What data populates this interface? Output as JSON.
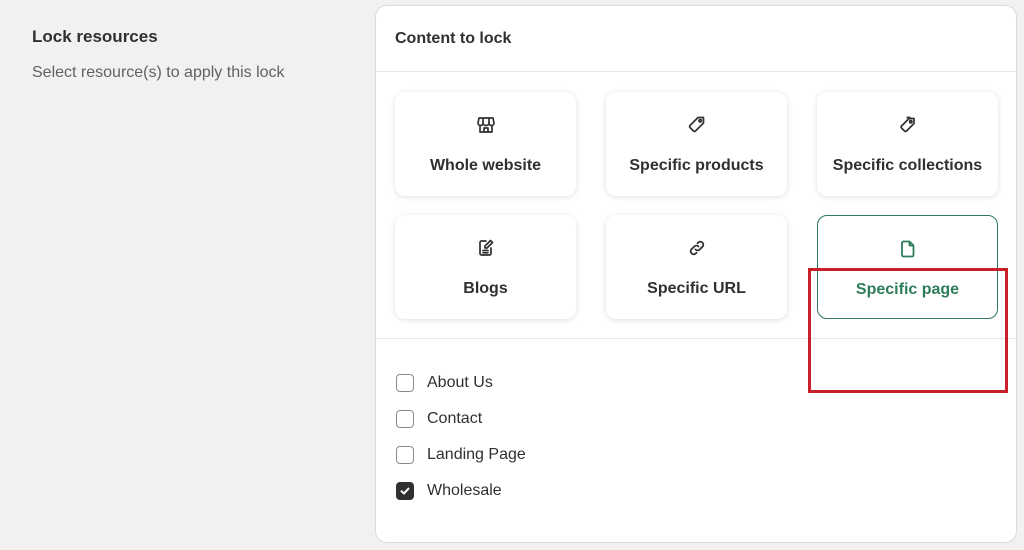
{
  "left": {
    "title": "Lock resources",
    "description": "Select resource(s) to apply this lock"
  },
  "card": {
    "title": "Content to lock",
    "options": [
      {
        "label": "Whole website",
        "icon": "store-icon",
        "selected": false
      },
      {
        "label": "Specific products",
        "icon": "tag-icon",
        "selected": false
      },
      {
        "label": "Specific collections",
        "icon": "tags-icon",
        "selected": false
      },
      {
        "label": "Blogs",
        "icon": "edit-document-icon",
        "selected": false
      },
      {
        "label": "Specific URL",
        "icon": "link-icon",
        "selected": false
      },
      {
        "label": "Specific page",
        "icon": "page-icon",
        "selected": true
      }
    ],
    "pages": [
      {
        "label": "About Us",
        "checked": false
      },
      {
        "label": "Contact",
        "checked": false
      },
      {
        "label": "Landing Page",
        "checked": false
      },
      {
        "label": "Wholesale",
        "checked": true
      }
    ]
  },
  "colors": {
    "accent": "#2e7d5a",
    "highlight": "#c8202a",
    "background": "#f1f1f1"
  }
}
